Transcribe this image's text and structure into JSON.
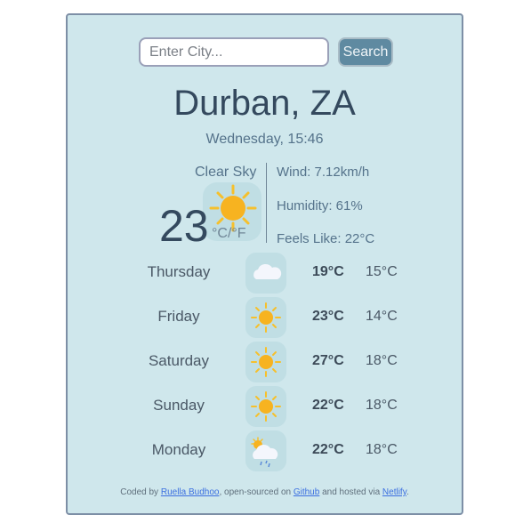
{
  "search": {
    "placeholder": "Enter City...",
    "value": "",
    "button_label": "Search"
  },
  "current": {
    "city": "Durban, ZA",
    "datetime": "Wednesday, 15:46",
    "condition": "Clear Sky",
    "icon": "sun-icon",
    "temperature": "23",
    "unit_c": "°C",
    "unit_sep": "/",
    "unit_f": "°F",
    "wind": "Wind: 7.12km/h",
    "humidity": "Humidity: 61%",
    "feels_like": "Feels Like: 22°C"
  },
  "forecast": [
    {
      "day": "Thursday",
      "icon": "cloud-icon",
      "high": "19°C",
      "low": "15°C"
    },
    {
      "day": "Friday",
      "icon": "sun-icon",
      "high": "23°C",
      "low": "14°C"
    },
    {
      "day": "Saturday",
      "icon": "sun-icon",
      "high": "27°C",
      "low": "18°C"
    },
    {
      "day": "Sunday",
      "icon": "sun-icon",
      "high": "22°C",
      "low": "18°C"
    },
    {
      "day": "Monday",
      "icon": "sun-cloud-rain-icon",
      "high": "22°C",
      "low": "18°C"
    }
  ],
  "footer": {
    "prefix": "Coded by ",
    "author": "Ruella Budhoo",
    "mid1": ", open-sourced on ",
    "repo": "Github",
    "mid2": " and hosted via ",
    "host": "Netlify",
    "suffix": "."
  }
}
